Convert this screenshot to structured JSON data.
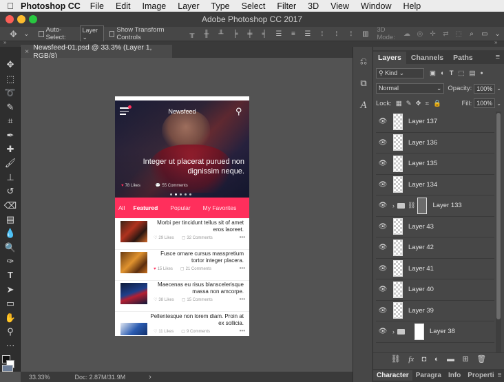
{
  "menubar": {
    "app": "Photoshop CC",
    "items": [
      "File",
      "Edit",
      "Image",
      "Layer",
      "Type",
      "Select",
      "Filter",
      "3D",
      "View",
      "Window",
      "Help"
    ]
  },
  "window": {
    "title": "Adobe Photoshop CC 2017",
    "traffic_colors": [
      "#fc5f57",
      "#fdbc2e",
      "#28c840"
    ]
  },
  "options": {
    "auto_select_label": "Auto-Select:",
    "auto_select_value": "Layer",
    "show_transform_label": "Show Transform Controls",
    "mode_label": "3D Mode:"
  },
  "document": {
    "tab_title": "Newsfeed-01.psd @ 33.3% (Layer 1, RGB/8)",
    "close_glyph": "×"
  },
  "status": {
    "zoom": "33.33%",
    "doc_info": "Doc: 2.87M/31.9M",
    "arrow": "›"
  },
  "tools": [
    "move-tool",
    "marquee-tool",
    "lasso-tool",
    "quick-select-tool",
    "crop-tool",
    "eyedropper-tool",
    "healing-tool",
    "brush-tool",
    "stamp-tool",
    "history-brush-tool",
    "eraser-tool",
    "gradient-tool",
    "blur-tool",
    "dodge-tool",
    "pen-tool",
    "type-tool",
    "path-select-tool",
    "shape-tool",
    "hand-tool",
    "zoom-tool",
    "more-tools"
  ],
  "panel": {
    "tabs": [
      "Layers",
      "Channels",
      "Paths"
    ],
    "active_tab": "Layers",
    "filter_kind": "Kind",
    "blend_mode": "Normal",
    "opacity_label": "Opacity:",
    "opacity_value": "100%",
    "lock_label": "Lock:",
    "fill_label": "Fill:",
    "fill_value": "100%",
    "layers": [
      {
        "name": "Layer 137",
        "kind": "layer"
      },
      {
        "name": "Layer 136",
        "kind": "layer"
      },
      {
        "name": "Layer 135",
        "kind": "layer"
      },
      {
        "name": "Layer 134",
        "kind": "layer"
      },
      {
        "name": "Layer 133",
        "kind": "group"
      },
      {
        "name": "Layer 43",
        "kind": "layer"
      },
      {
        "name": "Layer 42",
        "kind": "layer"
      },
      {
        "name": "Layer 41",
        "kind": "layer"
      },
      {
        "name": "Layer 40",
        "kind": "layer"
      },
      {
        "name": "Layer 39",
        "kind": "layer"
      },
      {
        "name": "Layer 38",
        "kind": "group"
      }
    ],
    "bottom_tabs": [
      "Character",
      "Paragra",
      "Info",
      "Properti"
    ]
  },
  "phone": {
    "header_title": "Newsfeed",
    "hero_text": "Integer ut placerat purued non dignissim neque.",
    "hero_likes": "78 Likes",
    "hero_comments": "55 Comments",
    "accent": "#ff2f5c",
    "tabs": [
      "All",
      "Featured",
      "Popular",
      "My Favorites"
    ],
    "active_tab": "Featured",
    "feed": [
      {
        "title": "Morbi per tincidunt tellus sit of amet eros laoreet.",
        "likes": "29 Likes",
        "comments": "32 Comments",
        "liked": false
      },
      {
        "title": "Fusce ornare cursus masspretium tortor integer placera.",
        "likes": "15 Likes",
        "comments": "21 Comments",
        "liked": true
      },
      {
        "title": "Maecenas eu risus blanscelerisque massa non amcorpe.",
        "likes": "38 Likes",
        "comments": "15 Comments",
        "liked": false
      },
      {
        "title": "Pellentesque non lorem diam. Proin at ex sollicia.",
        "likes": "11 Likes",
        "comments": "9 Comments",
        "liked": false
      }
    ]
  }
}
